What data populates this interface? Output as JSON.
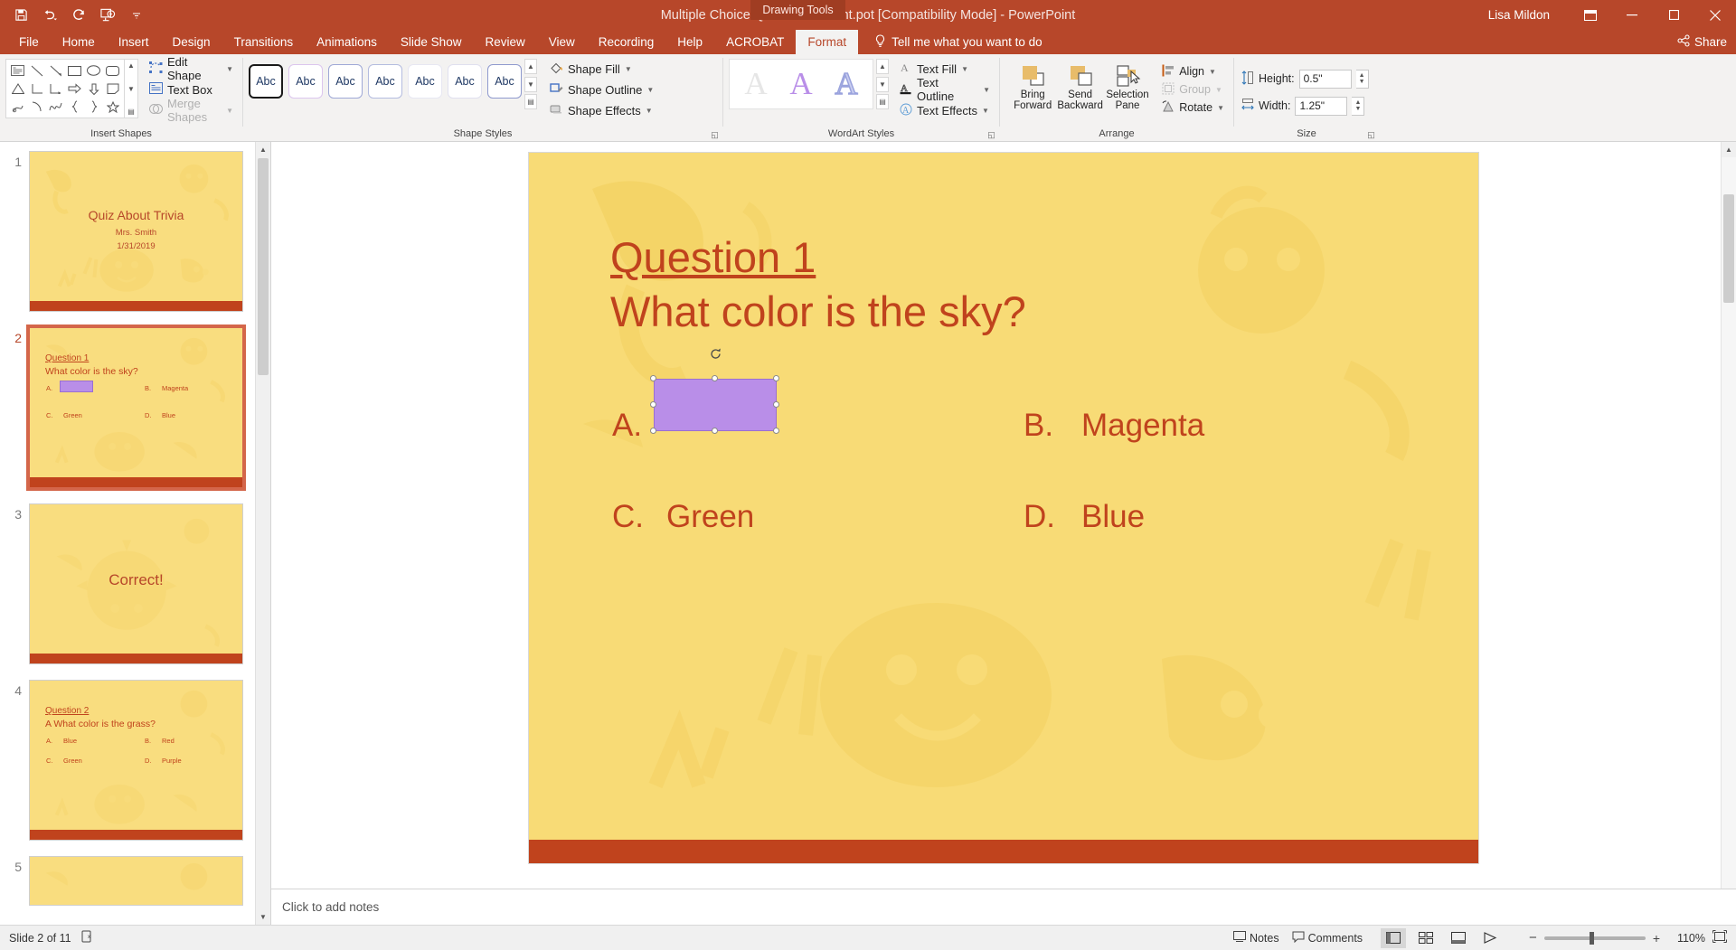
{
  "titlebar": {
    "quick_access": [
      "save-icon",
      "undo-icon",
      "redo-icon",
      "start-presentation-icon",
      "customize-qat-icon"
    ],
    "document_title": "Multiple Choice Quiz-PowerPoint.pot [Compatibility Mode]  -  PowerPoint",
    "contextual_tab_group": "Drawing Tools",
    "user_name": "Lisa Mildon",
    "window_buttons": [
      "ribbon-display-options-icon",
      "minimize-icon",
      "maximize-icon",
      "close-icon"
    ]
  },
  "tabs": {
    "items": [
      {
        "label": "File",
        "active": false
      },
      {
        "label": "Home",
        "active": false
      },
      {
        "label": "Insert",
        "active": false
      },
      {
        "label": "Design",
        "active": false
      },
      {
        "label": "Transitions",
        "active": false
      },
      {
        "label": "Animations",
        "active": false
      },
      {
        "label": "Slide Show",
        "active": false
      },
      {
        "label": "Review",
        "active": false
      },
      {
        "label": "View",
        "active": false
      },
      {
        "label": "Recording",
        "active": false
      },
      {
        "label": "Help",
        "active": false
      },
      {
        "label": "ACROBAT",
        "active": false
      },
      {
        "label": "Format",
        "active": true
      }
    ],
    "tell_me": "Tell me what you want to do",
    "share": "Share"
  },
  "ribbon": {
    "groups": [
      {
        "name": "Insert Shapes"
      },
      {
        "name": "Shape Styles"
      },
      {
        "name": "WordArt Styles"
      },
      {
        "name": "Arrange"
      },
      {
        "name": "Size"
      }
    ],
    "insert_shapes": {
      "buttons": [
        {
          "label": "Edit Shape",
          "icon": "edit-shape-icon",
          "disabled": false,
          "dropdown": true
        },
        {
          "label": "Text Box",
          "icon": "text-box-icon",
          "disabled": false,
          "dropdown": false
        },
        {
          "label": "Merge Shapes",
          "icon": "merge-shapes-icon",
          "disabled": true,
          "dropdown": true
        }
      ]
    },
    "shape_styles": {
      "gallery_label": "Abc",
      "gallery_count": 7,
      "commands": [
        {
          "label": "Shape Fill",
          "icon": "shape-fill-icon"
        },
        {
          "label": "Shape Outline",
          "icon": "shape-outline-icon"
        },
        {
          "label": "Shape Effects",
          "icon": "shape-effects-icon"
        }
      ]
    },
    "wordart_styles": {
      "gallery_glyph": "A",
      "commands": [
        {
          "label": "Text Fill",
          "icon": "text-fill-icon"
        },
        {
          "label": "Text Outline",
          "icon": "text-outline-icon"
        },
        {
          "label": "Text Effects",
          "icon": "text-effects-icon"
        }
      ]
    },
    "arrange": {
      "big_buttons": [
        {
          "label_line1": "Bring",
          "label_line2": "Forward",
          "icon": "bring-forward-icon",
          "disabled": false
        },
        {
          "label_line1": "Send",
          "label_line2": "Backward",
          "icon": "send-backward-icon",
          "disabled": false
        },
        {
          "label_line1": "Selection",
          "label_line2": "Pane",
          "icon": "selection-pane-icon",
          "disabled": false
        }
      ],
      "small_buttons": [
        {
          "label": "Align",
          "icon": "align-icon",
          "disabled": false
        },
        {
          "label": "Group",
          "icon": "group-icon",
          "disabled": true
        },
        {
          "label": "Rotate",
          "icon": "rotate-icon",
          "disabled": false
        }
      ]
    },
    "size": {
      "height_label": "Height:",
      "height_value": "0.5\"",
      "width_label": "Width:",
      "width_value": "1.25\""
    }
  },
  "thumbnails": [
    {
      "number": "1",
      "selected": false,
      "type": "title",
      "title": "Quiz About Trivia",
      "subtitle": "Mrs. Smith",
      "date": "1/31/2019"
    },
    {
      "number": "2",
      "selected": true,
      "type": "question",
      "heading": "Question 1",
      "question": "What color is the sky?",
      "options": [
        {
          "letter": "A.",
          "text": "",
          "swatch": true
        },
        {
          "letter": "B.",
          "text": "Magenta",
          "swatch": false
        },
        {
          "letter": "C.",
          "text": "Green",
          "swatch": false
        },
        {
          "letter": "D.",
          "text": "Blue",
          "swatch": false
        }
      ]
    },
    {
      "number": "3",
      "selected": false,
      "type": "answer",
      "title": "Correct!"
    },
    {
      "number": "4",
      "selected": false,
      "type": "question",
      "heading": "Question 2",
      "question": "A What color is the grass?",
      "options": [
        {
          "letter": "A.",
          "text": "Blue",
          "swatch": false
        },
        {
          "letter": "B.",
          "text": "Red",
          "swatch": false
        },
        {
          "letter": "C.",
          "text": "Green",
          "swatch": false
        },
        {
          "letter": "D.",
          "text": "Purple",
          "swatch": false
        }
      ]
    },
    {
      "number": "5",
      "selected": false,
      "type": "partial",
      "title": ""
    }
  ],
  "slide": {
    "heading": "Question 1",
    "question": "What color is the sky?",
    "options": [
      {
        "letter": "A.",
        "text": "",
        "swatch": true
      },
      {
        "letter": "B.",
        "text": "Magenta",
        "swatch": false
      },
      {
        "letter": "C.",
        "text": "Green",
        "swatch": false
      },
      {
        "letter": "D.",
        "text": "Blue",
        "swatch": false
      }
    ],
    "selected_shape": {
      "fill_color": "#b98ee8",
      "handles": 8,
      "rotation_handle": true
    }
  },
  "notes": {
    "placeholder": "Click to add notes"
  },
  "status": {
    "slide_indicator": "Slide 2 of 11",
    "accessibility_icon": "accessibility-checker-icon",
    "notes_label": "Notes",
    "notes_icon": "notes-icon",
    "comments_label": "Comments",
    "comments_icon": "comments-icon",
    "views": [
      {
        "name": "normal-view",
        "active": true
      },
      {
        "name": "slide-sorter-view",
        "active": false
      },
      {
        "name": "reading-view",
        "active": false
      },
      {
        "name": "slide-show-view",
        "active": false
      }
    ],
    "zoom_out_icon": "zoom-out-icon",
    "zoom_in_icon": "zoom-in-icon",
    "zoom_level": "110%",
    "fit_to_window_icon": "fit-slide-to-window-icon"
  },
  "colors": {
    "accent": "#b7472a",
    "slide_bg": "#f8db76",
    "slide_text": "#c0431d",
    "shape_fill": "#b98ee8"
  }
}
